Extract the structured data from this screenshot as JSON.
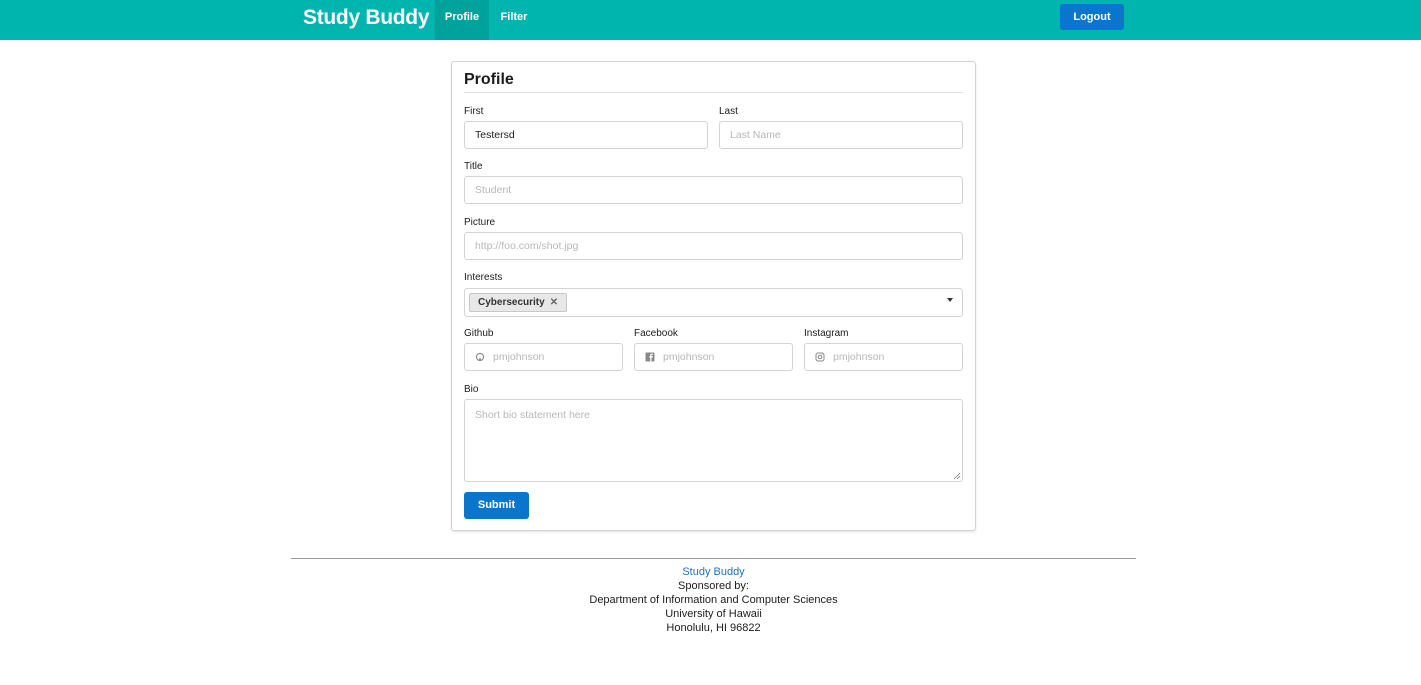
{
  "navbar": {
    "brand": "Study Buddy",
    "items": [
      {
        "label": "Profile",
        "active": true
      },
      {
        "label": "Filter",
        "active": false
      }
    ],
    "logout_label": "Logout",
    "color": "#00b5ad"
  },
  "profile_form": {
    "title": "Profile",
    "first": {
      "label": "First",
      "value": "Testersd"
    },
    "last": {
      "label": "Last",
      "placeholder": "Last Name"
    },
    "title_field": {
      "label": "Title",
      "placeholder": "Student"
    },
    "picture": {
      "label": "Picture",
      "placeholder": "http://foo.com/shot.jpg"
    },
    "interests": {
      "label": "Interests",
      "selected": [
        "Cybersecurity"
      ]
    },
    "github": {
      "label": "Github",
      "placeholder": "pmjohnson",
      "icon": "github-icon"
    },
    "facebook": {
      "label": "Facebook",
      "placeholder": "pmjohnson",
      "icon": "facebook-icon"
    },
    "instagram": {
      "label": "Instagram",
      "placeholder": "pmjohnson",
      "icon": "instagram-icon"
    },
    "bio": {
      "label": "Bio",
      "placeholder": "Short bio statement here"
    },
    "submit_label": "Submit",
    "button_color": "#0a75cc"
  },
  "footer": {
    "link": "Study Buddy",
    "sponsored": "Sponsored by:",
    "department": "Department of Information and Computer Sciences",
    "university": "University of Hawaii",
    "address": "Honolulu, HI 96822"
  }
}
